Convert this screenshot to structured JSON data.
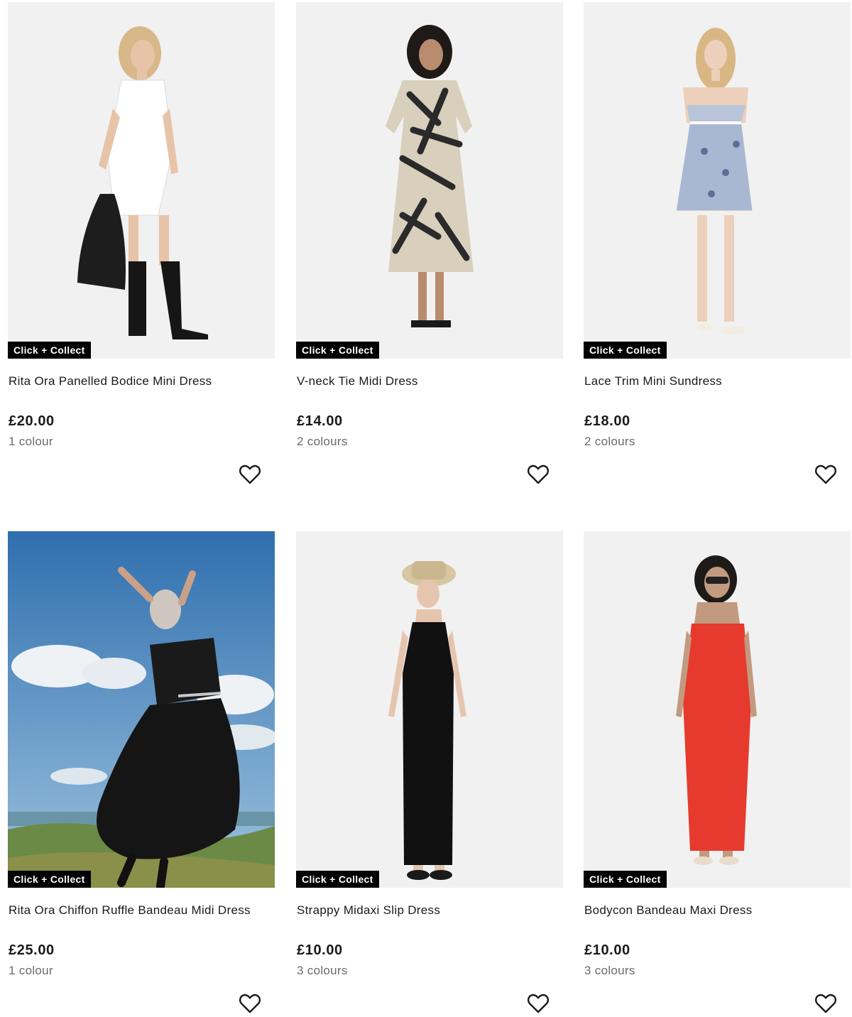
{
  "products": [
    {
      "badge": "Click + Collect",
      "name": "Rita Ora Panelled Bodice Mini Dress",
      "price": "£20.00",
      "colours": "1 colour",
      "image_icon": "white-mini-dress-photo"
    },
    {
      "badge": "Click + Collect",
      "name": "V-neck Tie Midi Dress",
      "price": "£14.00",
      "colours": "2 colours",
      "image_icon": "palm-print-midi-dress-photo"
    },
    {
      "badge": "Click + Collect",
      "name": "Lace Trim Mini Sundress",
      "price": "£18.00",
      "colours": "2 colours",
      "image_icon": "floral-mini-sundress-photo"
    },
    {
      "badge": "Click + Collect",
      "name": "Rita Ora Chiffon Ruffle Bandeau Midi Dress",
      "price": "£25.00",
      "colours": "1 colour",
      "image_icon": "black-chiffon-dress-outdoor-photo"
    },
    {
      "badge": "Click + Collect",
      "name": "Strappy Midaxi Slip Dress",
      "price": "£10.00",
      "colours": "3 colours",
      "image_icon": "black-slip-dress-photo"
    },
    {
      "badge": "Click + Collect",
      "name": "Bodycon Bandeau Maxi Dress",
      "price": "£10.00",
      "colours": "3 colours",
      "image_icon": "red-bandeau-maxi-dress-photo"
    }
  ],
  "colors": {
    "badge_bg": "#000000",
    "badge_text": "#ffffff",
    "price_text": "#1a1a1a",
    "muted_text": "#6b6b6b",
    "image_bg": "#f2f2f2"
  },
  "icons": {
    "wishlist": "heart-outline-icon"
  }
}
